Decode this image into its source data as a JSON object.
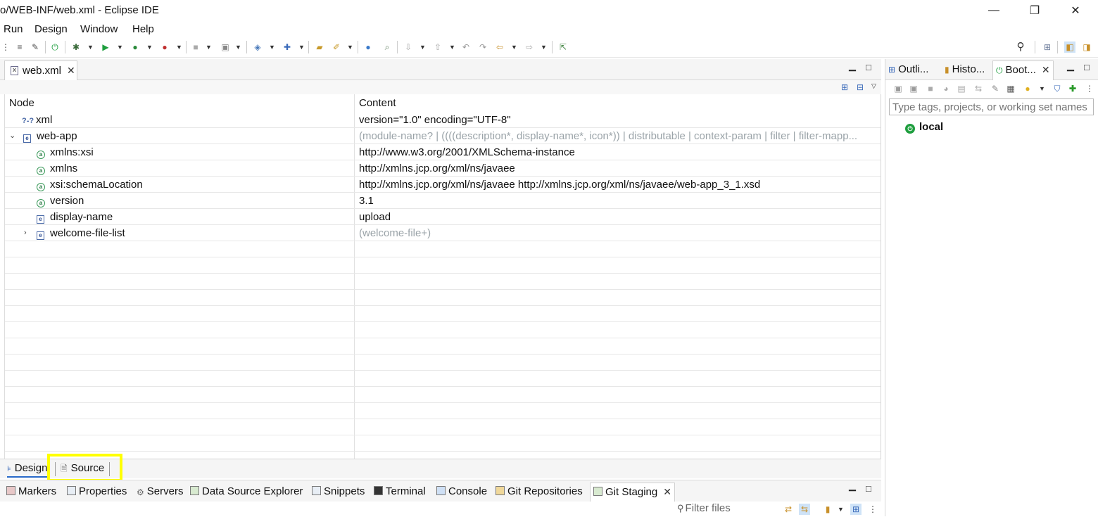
{
  "window": {
    "title": "o/WEB-INF/web.xml - Eclipse IDE",
    "minimize_glyph": "—",
    "restore_glyph": "❐",
    "close_glyph": "✕"
  },
  "menu": [
    "Run",
    "Design",
    "Window",
    "Help"
  ],
  "editor": {
    "tab_label": "web.xml",
    "tab_icon_glyph": "x",
    "columns": {
      "node": "Node",
      "content": "Content"
    },
    "rows": [
      {
        "node": "xml",
        "content": "version=\"1.0\" encoding=\"UTF-8\""
      },
      {
        "node": "web-app",
        "content": "(module-name? | ((((description*, display-name*, icon*)) | distributable | context-param | filter | filter-mapp..."
      },
      {
        "node": "xmlns:xsi",
        "content": "http://www.w3.org/2001/XMLSchema-instance"
      },
      {
        "node": "xmlns",
        "content": "http://xmlns.jcp.org/xml/ns/javaee"
      },
      {
        "node": "xsi:schemaLocation",
        "content": "http://xmlns.jcp.org/xml/ns/javaee http://xmlns.jcp.org/xml/ns/javaee/web-app_3_1.xsd"
      },
      {
        "node": "version",
        "content": "3.1"
      },
      {
        "node": "display-name",
        "content": "upload"
      },
      {
        "node": "welcome-file-list",
        "content": "(welcome-file+)"
      }
    ],
    "bottom_tabs": {
      "design": "Design",
      "source": "Source"
    }
  },
  "bottom_panel": {
    "tabs": [
      "Markers",
      "Properties",
      "Servers",
      "Data Source Explorer",
      "Snippets",
      "Terminal",
      "Console",
      "Git Repositories",
      "Git Staging"
    ],
    "filter_placeholder": "Filter files"
  },
  "right_panel": {
    "tabs": [
      "Outli...",
      "Histo...",
      "Boot..."
    ],
    "search_placeholder": "Type tags, projects, or working set names",
    "tree_item": "local"
  },
  "colors": {
    "highlight": "#ffff00",
    "grey_text": "#9aa3a8",
    "boot_green": "#1e9e3e"
  }
}
